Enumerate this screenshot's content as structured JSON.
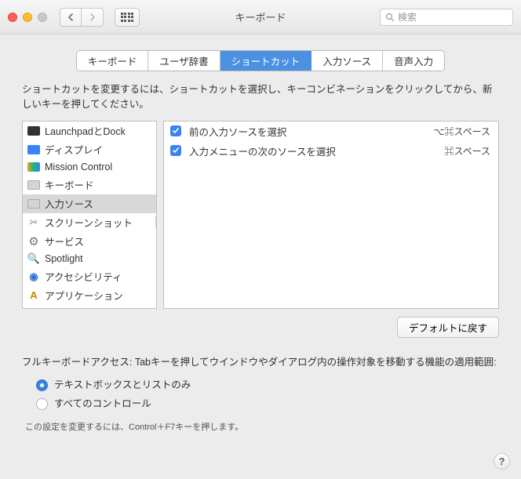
{
  "window": {
    "title": "キーボード"
  },
  "search": {
    "placeholder": "検索"
  },
  "tabs": [
    "キーボード",
    "ユーザ辞書",
    "ショートカット",
    "入力ソース",
    "音声入力"
  ],
  "selected_tab_index": 2,
  "description": "ショートカットを変更するには、ショートカットを選択し、キーコンビネーションをクリックしてから、新しいキーを押してください。",
  "categories": [
    {
      "label": "LaunchpadとDock"
    },
    {
      "label": "ディスプレイ"
    },
    {
      "label": "Mission Control"
    },
    {
      "label": "キーボード"
    },
    {
      "label": "入力ソース",
      "selected": true
    },
    {
      "label": "スクリーンショット"
    },
    {
      "label": "サービス"
    },
    {
      "label": "Spotlight"
    },
    {
      "label": "アクセシビリティ"
    },
    {
      "label": "アプリケーション"
    }
  ],
  "shortcuts": [
    {
      "checked": true,
      "label": "前の入力ソースを選択",
      "keys": "⌥⌘スペース"
    },
    {
      "checked": true,
      "label": "入力メニューの次のソースを選択",
      "keys": "⌘スペース"
    }
  ],
  "buttons": {
    "restore": "デフォルトに戻す"
  },
  "keyboard_access": {
    "label": "フルキーボードアクセス: Tabキーを押してウインドウやダイアログ内の操作対象を移動する機能の適用範囲:",
    "options": [
      "テキストボックスとリストのみ",
      "すべてのコントロール"
    ],
    "selected_index": 0,
    "hint": "この設定を変更するには、Control＋F7キーを押します。"
  },
  "help_glyph": "?"
}
